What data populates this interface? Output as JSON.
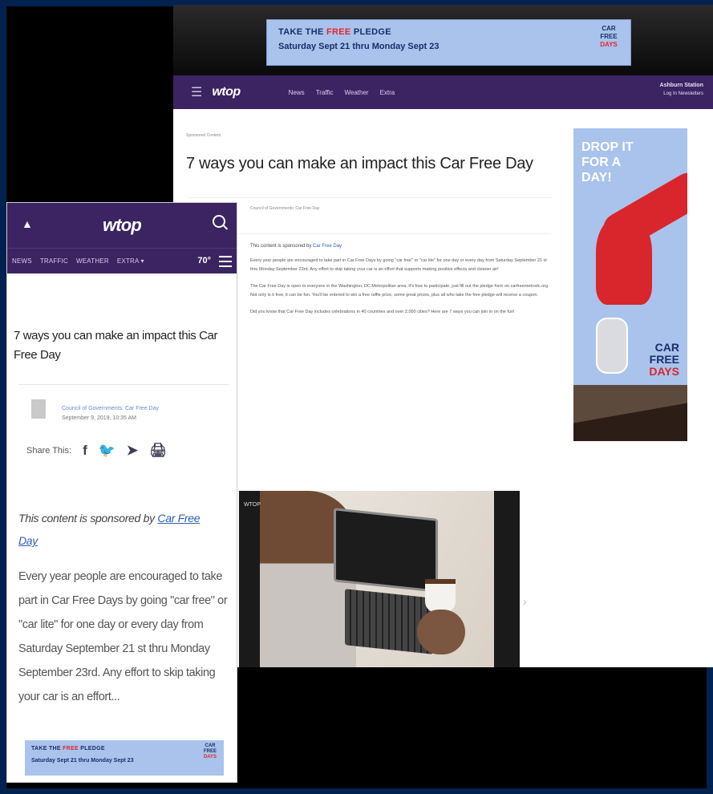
{
  "banner": {
    "line1_pre": "TAKE THE ",
    "line1_free": "FREE",
    "line1_post": " PLEDGE",
    "line2": "Saturday Sept 21 thru Monday Sept 23",
    "logo_lines": [
      "CAR",
      "FREE",
      "DAYS"
    ]
  },
  "desktop": {
    "nav": {
      "logo": "wtop",
      "links": [
        "News",
        "Traffic",
        "Weather",
        "Extra"
      ],
      "location": "Ashburn Station",
      "account": "Log In  Newsletters"
    },
    "breadcrumb": "Sponsored Content",
    "title": "7 ways you can make an impact this Car Free Day",
    "byline": "Council of Governments: Car Free Day",
    "sponsored_pre": "This content is sponsored by ",
    "sponsored_link": "Car Free Day",
    "paragraphs": [
      "Every year people are encouraged to take part in Car Free Days by going \"car free\" or \"car lite\" for one day or every day from Saturday September 21 st thru Monday September 23rd. Any effort to skip taking your car is an effort that supports making positive effects and cleaner air!",
      "The Car Free Day is open to everyone in the Washington, DC Metropolitan area. It's free to participate, just fill out the pledge form on carfreemetrodc.org. Not only is it free, it can be fun. You'll be entered to win a free raffle prize, some great prizes, plus all who take the free pledge will receive a coupon.",
      "Did you know that Car Free Day includes celebrations in 40 countries and over 2,000 cities? Here are 7 ways you can join in on the fun!"
    ],
    "video_label": "WTOP",
    "ad": {
      "headline_lines": [
        "DROP IT",
        "FOR A",
        "DAY!"
      ],
      "brand_lines": [
        "CAR",
        "FREE",
        "DAYS"
      ]
    }
  },
  "mobile": {
    "logo": "wtop",
    "subnav": [
      "NEWS",
      "TRAFFIC",
      "WEATHER",
      "EXTRA ▾"
    ],
    "temperature": "70°",
    "title": "7 ways you can make an impact this Car Free Day",
    "author": "Council of Governments: Car Free Day",
    "date": "September 9, 2019, 10:35 AM",
    "share_label": "Share This:",
    "share_icons": [
      "f",
      "🐦",
      "➤",
      "🖨"
    ],
    "sponsored_pre": "This content is sponsored by ",
    "sponsored_link": "Car Free Day",
    "body": "Every year people are encouraged to take part in Car Free Days by going \"car free\" or \"car lite\" for one day or every day from Saturday September 21 st thru Monday September 23rd. Any effort to skip taking your car is an effort..."
  },
  "colors": {
    "nav_purple": "#3b2461",
    "banner_blue": "#a9c3ec",
    "frame_blue": "#03214e",
    "accent_red": "#e3262e"
  }
}
